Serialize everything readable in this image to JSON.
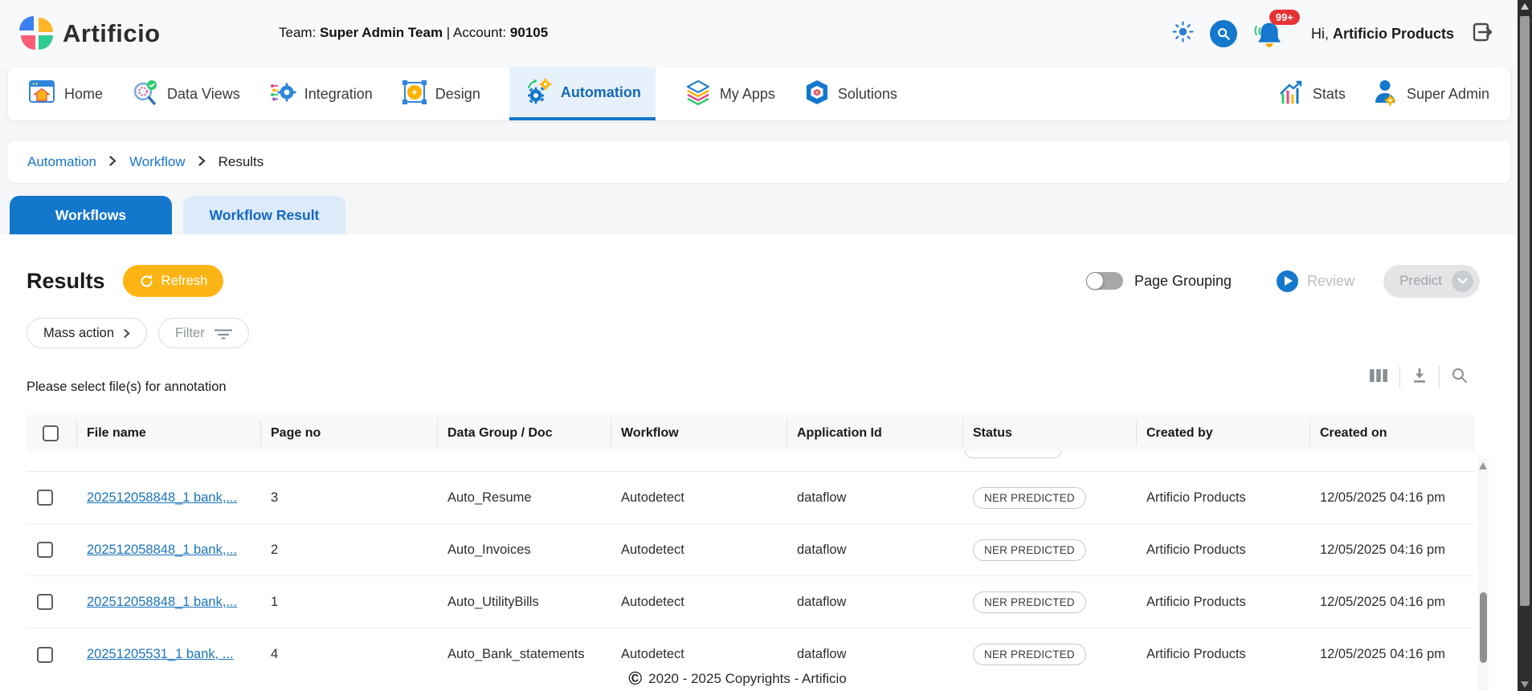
{
  "header": {
    "logo_text": "Artificio",
    "team_label": "Team:",
    "team_value": "Super Admin Team",
    "separator": "|",
    "account_label": "Account:",
    "account_value": "90105",
    "notification_count": "99+",
    "greeting_prefix": "Hi,",
    "greeting_name": "Artificio Products"
  },
  "nav": {
    "items": [
      {
        "label": "Home"
      },
      {
        "label": "Data Views"
      },
      {
        "label": "Integration"
      },
      {
        "label": "Design"
      },
      {
        "label": "Automation",
        "active": true
      },
      {
        "label": "My Apps"
      },
      {
        "label": "Solutions"
      }
    ],
    "right_items": [
      {
        "label": "Stats"
      },
      {
        "label": "Super Admin"
      }
    ]
  },
  "breadcrumb": {
    "items": [
      {
        "label": "Automation",
        "link": true
      },
      {
        "label": "Workflow",
        "link": true
      },
      {
        "label": "Results",
        "link": false
      }
    ]
  },
  "tabs": [
    {
      "label": "Workflows",
      "active": true
    },
    {
      "label": "Workflow Result",
      "active": false
    }
  ],
  "results": {
    "title": "Results",
    "refresh_label": "Refresh",
    "page_grouping_label": "Page Grouping",
    "review_label": "Review",
    "predict_label": "Predict",
    "mass_action_label": "Mass action",
    "filter_label": "Filter",
    "hint": "Please select file(s) for annotation"
  },
  "table": {
    "columns": [
      "File name",
      "Page no",
      "Data Group / Doc",
      "Workflow",
      "Application Id",
      "Status",
      "Created by",
      "Created on"
    ],
    "rows": [
      {
        "file_name": "202512058848_1 bank,...",
        "page_no": "3",
        "data_group": "Auto_Resume",
        "workflow": "Autodetect",
        "application_id": "dataflow",
        "status": "NER PREDICTED",
        "created_by": "Artificio Products",
        "created_on": "12/05/2025 04:16 pm"
      },
      {
        "file_name": "202512058848_1 bank,...",
        "page_no": "2",
        "data_group": "Auto_Invoices",
        "workflow": "Autodetect",
        "application_id": "dataflow",
        "status": "NER PREDICTED",
        "created_by": "Artificio Products",
        "created_on": "12/05/2025 04:16 pm"
      },
      {
        "file_name": "202512058848_1 bank,...",
        "page_no": "1",
        "data_group": "Auto_UtilityBills",
        "workflow": "Autodetect",
        "application_id": "dataflow",
        "status": "NER PREDICTED",
        "created_by": "Artificio Products",
        "created_on": "12/05/2025 04:16 pm"
      },
      {
        "file_name": "20251205531_1 bank, ...",
        "page_no": "4",
        "data_group": "Auto_Bank_statements",
        "workflow": "Autodetect",
        "application_id": "dataflow",
        "status": "NER PREDICTED",
        "created_by": "Artificio Products",
        "created_on": "12/05/2025 04:16 pm"
      }
    ]
  },
  "footer": {
    "symbol": "©",
    "text": "2020 - 2025 Copyrights - Artificio"
  },
  "colors": {
    "primary_blue": "#1377cb",
    "refresh_orange": "#fdb515",
    "badge_red": "#e53434",
    "link_blue": "#1b74bb"
  }
}
